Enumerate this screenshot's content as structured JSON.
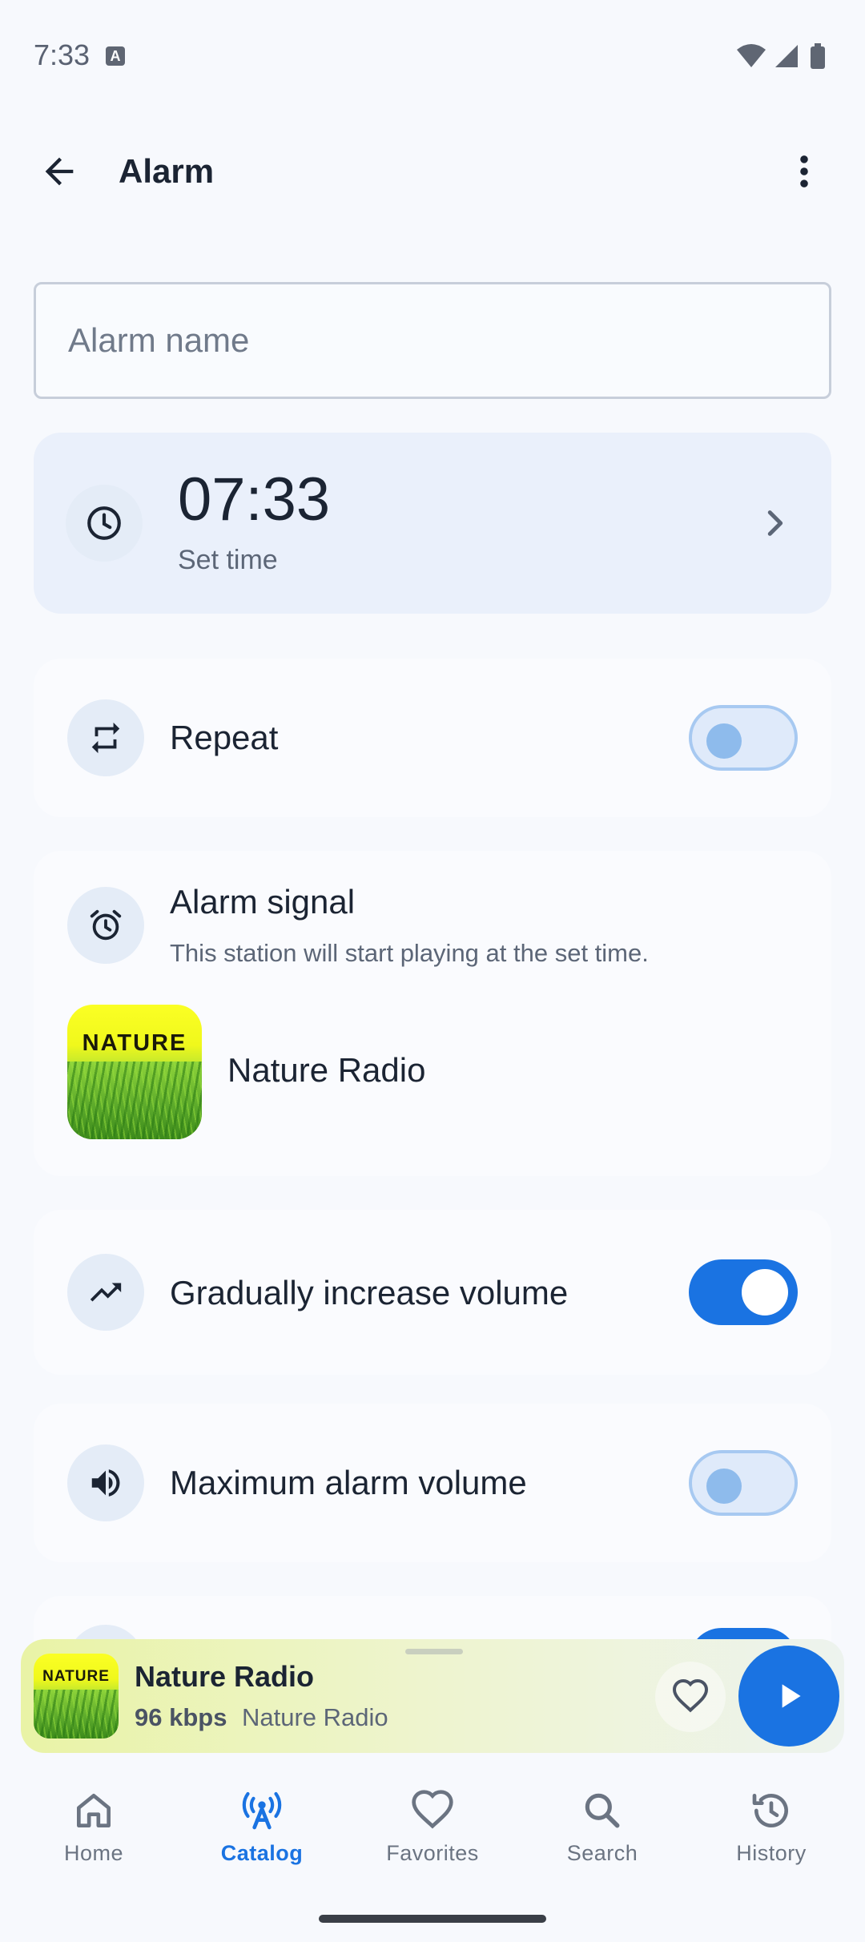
{
  "status_bar": {
    "time": "7:33",
    "indicator": "A"
  },
  "app_bar": {
    "title": "Alarm"
  },
  "alarm_name": {
    "value": "",
    "placeholder": "Alarm name"
  },
  "time_card": {
    "time": "07:33",
    "subtitle": "Set time"
  },
  "repeat": {
    "label": "Repeat",
    "enabled": false
  },
  "alarm_signal": {
    "title": "Alarm signal",
    "description": "This station will start playing at the set time.",
    "station_name": "Nature Radio",
    "station_art_text": "NATURE"
  },
  "gradual_volume": {
    "label": "Gradually increase volume",
    "enabled": true
  },
  "max_volume": {
    "label": "Maximum alarm volume",
    "enabled": false
  },
  "mini_player": {
    "title": "Nature Radio",
    "bitrate": "96 kbps",
    "subtitle": "Nature Radio",
    "art_text": "NATURE"
  },
  "bottom_nav": {
    "items": [
      {
        "label": "Home",
        "icon": "home-icon",
        "active": false
      },
      {
        "label": "Catalog",
        "icon": "radio-tower-icon",
        "active": true
      },
      {
        "label": "Favorites",
        "icon": "heart-icon",
        "active": false
      },
      {
        "label": "Search",
        "icon": "search-icon",
        "active": false
      },
      {
        "label": "History",
        "icon": "history-icon",
        "active": false
      }
    ]
  },
  "colors": {
    "accent": "#1a73e2",
    "background": "#f7f9fd",
    "card": "#eaf0fb"
  }
}
